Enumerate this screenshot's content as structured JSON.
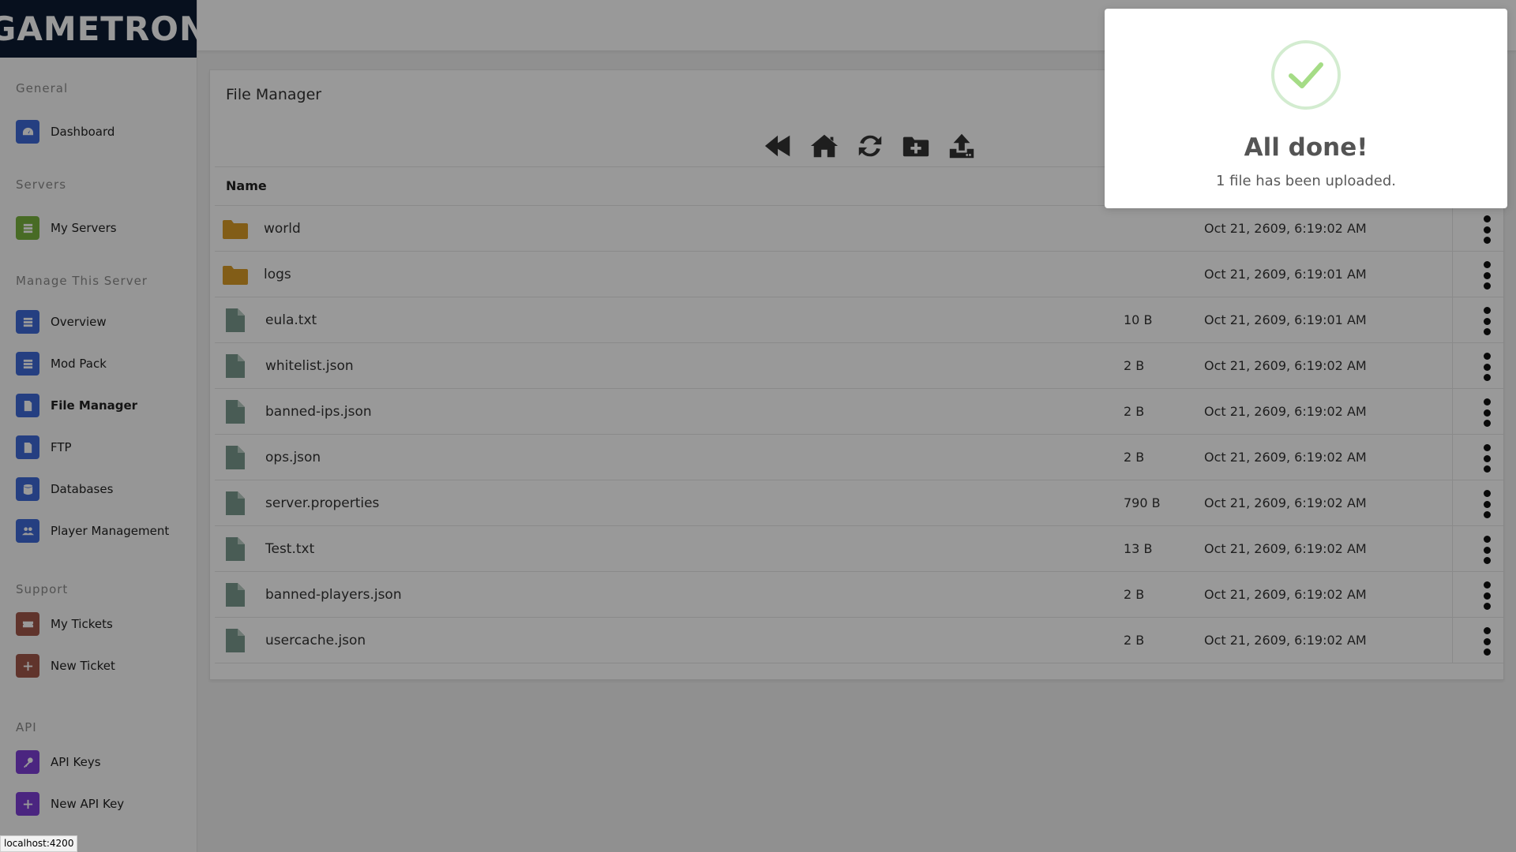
{
  "app": {
    "logo": "GAMETRON"
  },
  "sidebar": {
    "sections": [
      {
        "label": "General",
        "items": [
          {
            "label": "Dashboard",
            "icon": "gauge-icon",
            "color": "#3f6ad8"
          }
        ]
      },
      {
        "label": "Servers",
        "items": [
          {
            "label": "My Servers",
            "icon": "server-list-icon",
            "color": "#79b23f"
          }
        ]
      },
      {
        "label": "Manage This Server",
        "items": [
          {
            "label": "Overview",
            "icon": "list-icon",
            "color": "#3f6ad8"
          },
          {
            "label": "Mod Pack",
            "icon": "list-icon",
            "color": "#3f6ad8"
          },
          {
            "label": "File Manager",
            "icon": "file-icon",
            "color": "#3f6ad8",
            "active": true
          },
          {
            "label": "FTP",
            "icon": "file-icon",
            "color": "#3f6ad8"
          },
          {
            "label": "Databases",
            "icon": "database-icon",
            "color": "#3f6ad8"
          },
          {
            "label": "Player Management",
            "icon": "users-icon",
            "color": "#3f6ad8"
          }
        ]
      },
      {
        "label": "Support",
        "items": [
          {
            "label": "My Tickets",
            "icon": "ticket-icon",
            "color": "#a0574a"
          },
          {
            "label": "New Ticket",
            "icon": "plus-icon",
            "color": "#a0574a"
          }
        ]
      },
      {
        "label": "API",
        "items": [
          {
            "label": "API Keys",
            "icon": "key-icon",
            "color": "#7d3fd6"
          },
          {
            "label": "New API Key",
            "icon": "plus-icon",
            "color": "#7d3fd6"
          }
        ]
      }
    ]
  },
  "file_manager": {
    "title": "File Manager",
    "toolbar": [
      {
        "name": "back",
        "icon": "fast-backward-icon"
      },
      {
        "name": "home",
        "icon": "home-icon"
      },
      {
        "name": "refresh",
        "icon": "refresh-icon"
      },
      {
        "name": "new-folder",
        "icon": "folder-plus-icon"
      },
      {
        "name": "upload",
        "icon": "upload-icon"
      }
    ],
    "column_name": "Name",
    "files": [
      {
        "name": "world",
        "type": "folder",
        "size": "",
        "date": "Oct 21, 2609, 6:19:02 AM"
      },
      {
        "name": "logs",
        "type": "folder",
        "size": "",
        "date": "Oct 21, 2609, 6:19:01 AM"
      },
      {
        "name": "eula.txt",
        "type": "file",
        "size": "10 B",
        "date": "Oct 21, 2609, 6:19:01 AM"
      },
      {
        "name": "whitelist.json",
        "type": "file",
        "size": "2 B",
        "date": "Oct 21, 2609, 6:19:02 AM"
      },
      {
        "name": "banned-ips.json",
        "type": "file",
        "size": "2 B",
        "date": "Oct 21, 2609, 6:19:02 AM"
      },
      {
        "name": "ops.json",
        "type": "file",
        "size": "2 B",
        "date": "Oct 21, 2609, 6:19:02 AM"
      },
      {
        "name": "server.properties",
        "type": "file",
        "size": "790 B",
        "date": "Oct 21, 2609, 6:19:02 AM"
      },
      {
        "name": "Test.txt",
        "type": "file",
        "size": "13 B",
        "date": "Oct 21, 2609, 6:19:02 AM"
      },
      {
        "name": "banned-players.json",
        "type": "file",
        "size": "2 B",
        "date": "Oct 21, 2609, 6:19:02 AM"
      },
      {
        "name": "usercache.json",
        "type": "file",
        "size": "2 B",
        "date": "Oct 21, 2609, 6:19:02 AM"
      }
    ]
  },
  "toast": {
    "title": "All done!",
    "text": "1 file has been uploaded.",
    "icon": "check-icon",
    "accent": "#a5dc86"
  },
  "statusbar": {
    "url": "localhost:4200"
  },
  "colors": {
    "folder": "#d99b27",
    "file": "#7a9a8e",
    "logo_bg": "#0d1b33"
  }
}
